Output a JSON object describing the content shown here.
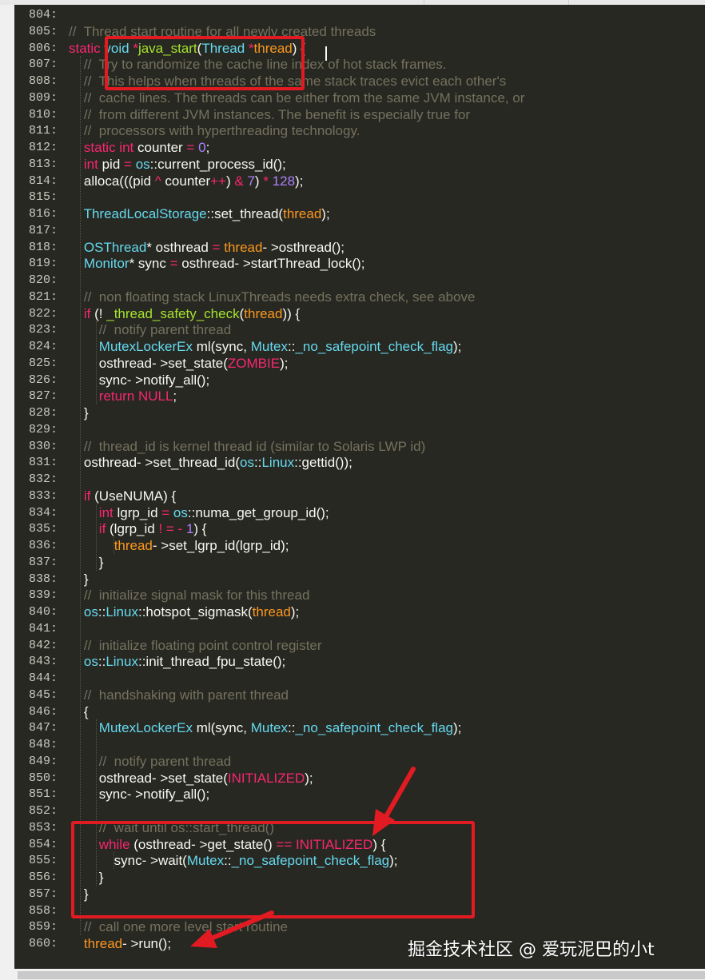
{
  "lines": [
    {
      "n": "804:",
      "tokens": []
    },
    {
      "n": "805:",
      "tokens": [
        {
          "t": "//  Thread start routine for all newly created threads",
          "c": "cm"
        }
      ]
    },
    {
      "n": "806:",
      "tokens": [
        {
          "t": "static",
          "c": "kw"
        },
        {
          "t": " void ",
          "c": "ty"
        },
        {
          "t": "*",
          "c": "kw"
        },
        {
          "t": "java_start",
          "c": "fn"
        },
        {
          "t": "(",
          "c": ""
        },
        {
          "t": "Thread",
          "c": "ty"
        },
        {
          "t": " *",
          "c": "kw"
        },
        {
          "t": "thread",
          "c": "pa"
        },
        {
          "t": ") {",
          "c": ""
        }
      ]
    },
    {
      "n": "807:",
      "tokens": [
        {
          "t": "    //  Try to randomize the cache line index of hot stack frames.",
          "c": "cm"
        }
      ]
    },
    {
      "n": "808:",
      "tokens": [
        {
          "t": "    //  This helps when threads of the same stack traces evict each other's",
          "c": "cm"
        }
      ]
    },
    {
      "n": "809:",
      "tokens": [
        {
          "t": "    //  cache lines. The threads can be either from the same JVM instance, or",
          "c": "cm"
        }
      ]
    },
    {
      "n": "810:",
      "tokens": [
        {
          "t": "    //  from different JVM instances. The benefit is especially true for",
          "c": "cm"
        }
      ]
    },
    {
      "n": "811:",
      "tokens": [
        {
          "t": "    //  processors with hyperthreading technology.",
          "c": "cm"
        }
      ]
    },
    {
      "n": "812:",
      "tokens": [
        {
          "t": "    ",
          "c": ""
        },
        {
          "t": "static int",
          "c": "kw"
        },
        {
          "t": " counter ",
          "c": ""
        },
        {
          "t": "=",
          "c": "kw"
        },
        {
          "t": " ",
          "c": ""
        },
        {
          "t": "0",
          "c": "nu"
        },
        {
          "t": ";",
          "c": ""
        }
      ]
    },
    {
      "n": "813:",
      "tokens": [
        {
          "t": "    ",
          "c": ""
        },
        {
          "t": "int",
          "c": "kw"
        },
        {
          "t": " pid ",
          "c": ""
        },
        {
          "t": "=",
          "c": "kw"
        },
        {
          "t": " ",
          "c": ""
        },
        {
          "t": "os",
          "c": "ty"
        },
        {
          "t": "::current_process_id();",
          "c": ""
        }
      ]
    },
    {
      "n": "814:",
      "tokens": [
        {
          "t": "    alloca(((pid ",
          "c": ""
        },
        {
          "t": "^",
          "c": "kw"
        },
        {
          "t": " counter",
          "c": ""
        },
        {
          "t": "++",
          "c": "kw"
        },
        {
          "t": ") ",
          "c": ""
        },
        {
          "t": "&",
          "c": "kw"
        },
        {
          "t": " ",
          "c": ""
        },
        {
          "t": "7",
          "c": "nu"
        },
        {
          "t": ") ",
          "c": ""
        },
        {
          "t": "*",
          "c": "kw"
        },
        {
          "t": " ",
          "c": ""
        },
        {
          "t": "128",
          "c": "nu"
        },
        {
          "t": ");",
          "c": ""
        }
      ]
    },
    {
      "n": "815:",
      "tokens": []
    },
    {
      "n": "816:",
      "tokens": [
        {
          "t": "    ",
          "c": ""
        },
        {
          "t": "ThreadLocalStorage",
          "c": "ty"
        },
        {
          "t": "::set_thread(",
          "c": ""
        },
        {
          "t": "thread",
          "c": "pa"
        },
        {
          "t": ");",
          "c": ""
        }
      ]
    },
    {
      "n": "817:",
      "tokens": []
    },
    {
      "n": "818:",
      "tokens": [
        {
          "t": "    ",
          "c": ""
        },
        {
          "t": "OSThread",
          "c": "ty"
        },
        {
          "t": "* osthread ",
          "c": ""
        },
        {
          "t": "=",
          "c": "kw"
        },
        {
          "t": " ",
          "c": ""
        },
        {
          "t": "thread",
          "c": "pa"
        },
        {
          "t": "- >osthread();",
          "c": ""
        }
      ]
    },
    {
      "n": "819:",
      "tokens": [
        {
          "t": "    ",
          "c": ""
        },
        {
          "t": "Monitor",
          "c": "ty"
        },
        {
          "t": "* sync ",
          "c": ""
        },
        {
          "t": "=",
          "c": "kw"
        },
        {
          "t": " osthread- >startThread_lock();",
          "c": ""
        }
      ]
    },
    {
      "n": "820:",
      "tokens": []
    },
    {
      "n": "821:",
      "tokens": [
        {
          "t": "    //  non floating stack LinuxThreads needs extra check, see above",
          "c": "cm"
        }
      ]
    },
    {
      "n": "822:",
      "tokens": [
        {
          "t": "    ",
          "c": ""
        },
        {
          "t": "if",
          "c": "kw"
        },
        {
          "t": " (! ",
          "c": ""
        },
        {
          "t": "_thread_safety_check",
          "c": "fn"
        },
        {
          "t": "(",
          "c": ""
        },
        {
          "t": "thread",
          "c": "pa"
        },
        {
          "t": ")) {",
          "c": ""
        }
      ]
    },
    {
      "n": "823:",
      "tokens": [
        {
          "t": "        //  notify parent thread",
          "c": "cm"
        }
      ]
    },
    {
      "n": "824:",
      "tokens": [
        {
          "t": "        ",
          "c": ""
        },
        {
          "t": "MutexLockerEx",
          "c": "ty"
        },
        {
          "t": " ml(sync, ",
          "c": ""
        },
        {
          "t": "Mutex",
          "c": "ty"
        },
        {
          "t": "::",
          "c": ""
        },
        {
          "t": "_no_safepoint_check_flag",
          "c": "ty"
        },
        {
          "t": ");",
          "c": ""
        }
      ]
    },
    {
      "n": "825:",
      "tokens": [
        {
          "t": "        osthread- >set_state(",
          "c": ""
        },
        {
          "t": "ZOMBIE",
          "c": "co"
        },
        {
          "t": ");",
          "c": ""
        }
      ]
    },
    {
      "n": "826:",
      "tokens": [
        {
          "t": "        sync- >notify_all();",
          "c": ""
        }
      ]
    },
    {
      "n": "827:",
      "tokens": [
        {
          "t": "        ",
          "c": ""
        },
        {
          "t": "return",
          "c": "kw"
        },
        {
          "t": " ",
          "c": ""
        },
        {
          "t": "NULL",
          "c": "co"
        },
        {
          "t": ";",
          "c": ""
        }
      ]
    },
    {
      "n": "828:",
      "tokens": [
        {
          "t": "    }",
          "c": ""
        }
      ]
    },
    {
      "n": "829:",
      "tokens": []
    },
    {
      "n": "830:",
      "tokens": [
        {
          "t": "    //  thread_id is kernel thread id (similar to Solaris LWP id)",
          "c": "cm"
        }
      ]
    },
    {
      "n": "831:",
      "tokens": [
        {
          "t": "    osthread- >set_thread_id(",
          "c": ""
        },
        {
          "t": "os",
          "c": "ty"
        },
        {
          "t": "::",
          "c": ""
        },
        {
          "t": "Linux",
          "c": "ty"
        },
        {
          "t": "::gettid());",
          "c": ""
        }
      ]
    },
    {
      "n": "832:",
      "tokens": []
    },
    {
      "n": "833:",
      "tokens": [
        {
          "t": "    ",
          "c": ""
        },
        {
          "t": "if",
          "c": "kw"
        },
        {
          "t": " (UseNUMA) {",
          "c": ""
        }
      ]
    },
    {
      "n": "834:",
      "tokens": [
        {
          "t": "        ",
          "c": ""
        },
        {
          "t": "int",
          "c": "kw"
        },
        {
          "t": " lgrp_id ",
          "c": ""
        },
        {
          "t": "=",
          "c": "kw"
        },
        {
          "t": " ",
          "c": ""
        },
        {
          "t": "os",
          "c": "ty"
        },
        {
          "t": "::numa_get_group_id();",
          "c": ""
        }
      ]
    },
    {
      "n": "835:",
      "tokens": [
        {
          "t": "        ",
          "c": ""
        },
        {
          "t": "if",
          "c": "kw"
        },
        {
          "t": " (lgrp_id ",
          "c": ""
        },
        {
          "t": "! = -",
          "c": "kw"
        },
        {
          "t": " ",
          "c": ""
        },
        {
          "t": "1",
          "c": "nu"
        },
        {
          "t": ") {",
          "c": ""
        }
      ]
    },
    {
      "n": "836:",
      "tokens": [
        {
          "t": "            ",
          "c": ""
        },
        {
          "t": "thread",
          "c": "pa"
        },
        {
          "t": "- >set_lgrp_id(lgrp_id);",
          "c": ""
        }
      ]
    },
    {
      "n": "837:",
      "tokens": [
        {
          "t": "        }",
          "c": ""
        }
      ]
    },
    {
      "n": "838:",
      "tokens": [
        {
          "t": "    }",
          "c": ""
        }
      ]
    },
    {
      "n": "839:",
      "tokens": [
        {
          "t": "    //  initialize signal mask for this thread",
          "c": "cm"
        }
      ]
    },
    {
      "n": "840:",
      "tokens": [
        {
          "t": "    ",
          "c": ""
        },
        {
          "t": "os",
          "c": "ty"
        },
        {
          "t": "::",
          "c": ""
        },
        {
          "t": "Linux",
          "c": "ty"
        },
        {
          "t": "::hotspot_sigmask(",
          "c": ""
        },
        {
          "t": "thread",
          "c": "pa"
        },
        {
          "t": ");",
          "c": ""
        }
      ]
    },
    {
      "n": "841:",
      "tokens": []
    },
    {
      "n": "842:",
      "tokens": [
        {
          "t": "    //  initialize floating point control register",
          "c": "cm"
        }
      ]
    },
    {
      "n": "843:",
      "tokens": [
        {
          "t": "    ",
          "c": ""
        },
        {
          "t": "os",
          "c": "ty"
        },
        {
          "t": "::",
          "c": ""
        },
        {
          "t": "Linux",
          "c": "ty"
        },
        {
          "t": "::init_thread_fpu_state();",
          "c": ""
        }
      ]
    },
    {
      "n": "844:",
      "tokens": []
    },
    {
      "n": "845:",
      "tokens": [
        {
          "t": "    //  handshaking with parent thread",
          "c": "cm"
        }
      ]
    },
    {
      "n": "846:",
      "tokens": [
        {
          "t": "    {",
          "c": ""
        }
      ]
    },
    {
      "n": "847:",
      "tokens": [
        {
          "t": "        ",
          "c": ""
        },
        {
          "t": "MutexLockerEx",
          "c": "ty"
        },
        {
          "t": " ml(sync, ",
          "c": ""
        },
        {
          "t": "Mutex",
          "c": "ty"
        },
        {
          "t": "::",
          "c": ""
        },
        {
          "t": "_no_safepoint_check_flag",
          "c": "ty"
        },
        {
          "t": ");",
          "c": ""
        }
      ]
    },
    {
      "n": "848:",
      "tokens": []
    },
    {
      "n": "849:",
      "tokens": [
        {
          "t": "        //  notify parent thread",
          "c": "cm"
        }
      ]
    },
    {
      "n": "850:",
      "tokens": [
        {
          "t": "        osthread- >set_state(",
          "c": ""
        },
        {
          "t": "INITIALIZED",
          "c": "co"
        },
        {
          "t": ");",
          "c": ""
        }
      ]
    },
    {
      "n": "851:",
      "tokens": [
        {
          "t": "        sync- >notify_all();",
          "c": ""
        }
      ]
    },
    {
      "n": "852:",
      "tokens": []
    },
    {
      "n": "853:",
      "tokens": [
        {
          "t": "        //  wait until os::start_thread()",
          "c": "cm"
        }
      ]
    },
    {
      "n": "854:",
      "tokens": [
        {
          "t": "        ",
          "c": ""
        },
        {
          "t": "while",
          "c": "kw"
        },
        {
          "t": " (osthread- >get_state() ",
          "c": ""
        },
        {
          "t": "==",
          "c": "kw"
        },
        {
          "t": " ",
          "c": ""
        },
        {
          "t": "INITIALIZED",
          "c": "co"
        },
        {
          "t": ") {",
          "c": ""
        }
      ]
    },
    {
      "n": "855:",
      "tokens": [
        {
          "t": "            sync- >wait(",
          "c": ""
        },
        {
          "t": "Mutex",
          "c": "ty"
        },
        {
          "t": "::",
          "c": ""
        },
        {
          "t": "_no_safepoint_check_flag",
          "c": "ty"
        },
        {
          "t": ");",
          "c": ""
        }
      ]
    },
    {
      "n": "856:",
      "tokens": [
        {
          "t": "        }",
          "c": ""
        }
      ]
    },
    {
      "n": "857:",
      "tokens": [
        {
          "t": "    }",
          "c": ""
        }
      ]
    },
    {
      "n": "858:",
      "tokens": []
    },
    {
      "n": "859:",
      "tokens": [
        {
          "t": "    //  call one more level start routine",
          "c": "cm"
        }
      ]
    },
    {
      "n": "860:",
      "tokens": [
        {
          "t": "    ",
          "c": ""
        },
        {
          "t": "thread",
          "c": "pa"
        },
        {
          "t": "- >run();",
          "c": ""
        }
      ]
    }
  ],
  "watermark": "掘金技术社区 @ 爱玩泥巴的小t",
  "colors": {
    "background": "#272822",
    "foreground": "#f8f8f2",
    "keyword": "#f92672",
    "type": "#66d9ef",
    "function": "#a6e22e",
    "parameter": "#fd971f",
    "number": "#ae81ff",
    "comment": "#75715e",
    "annotation": "#e21a22"
  }
}
